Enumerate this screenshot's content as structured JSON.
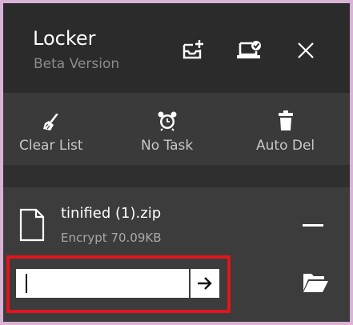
{
  "app": {
    "title": "Locker",
    "subtitle": "Beta Version"
  },
  "titlebar": {
    "icons": [
      "tray-add-icon",
      "laptop-check-icon",
      "close-icon"
    ]
  },
  "toolbar": {
    "clear_list": "Clear List",
    "no_task": "No Task",
    "auto_del": "Auto Del"
  },
  "file": {
    "name": "tinified (1).zip",
    "meta": "Encrypt 70.09KB",
    "password_value": "",
    "icons": [
      "file-icon",
      "minus-icon",
      "arrow-right-icon",
      "folder-icon"
    ]
  },
  "colors": {
    "background": "#2b2b2b",
    "toolbar": "#3a3a3a",
    "item": "#3c3c3c",
    "highlight": "#e1151b",
    "border": "#d9b3d6"
  }
}
